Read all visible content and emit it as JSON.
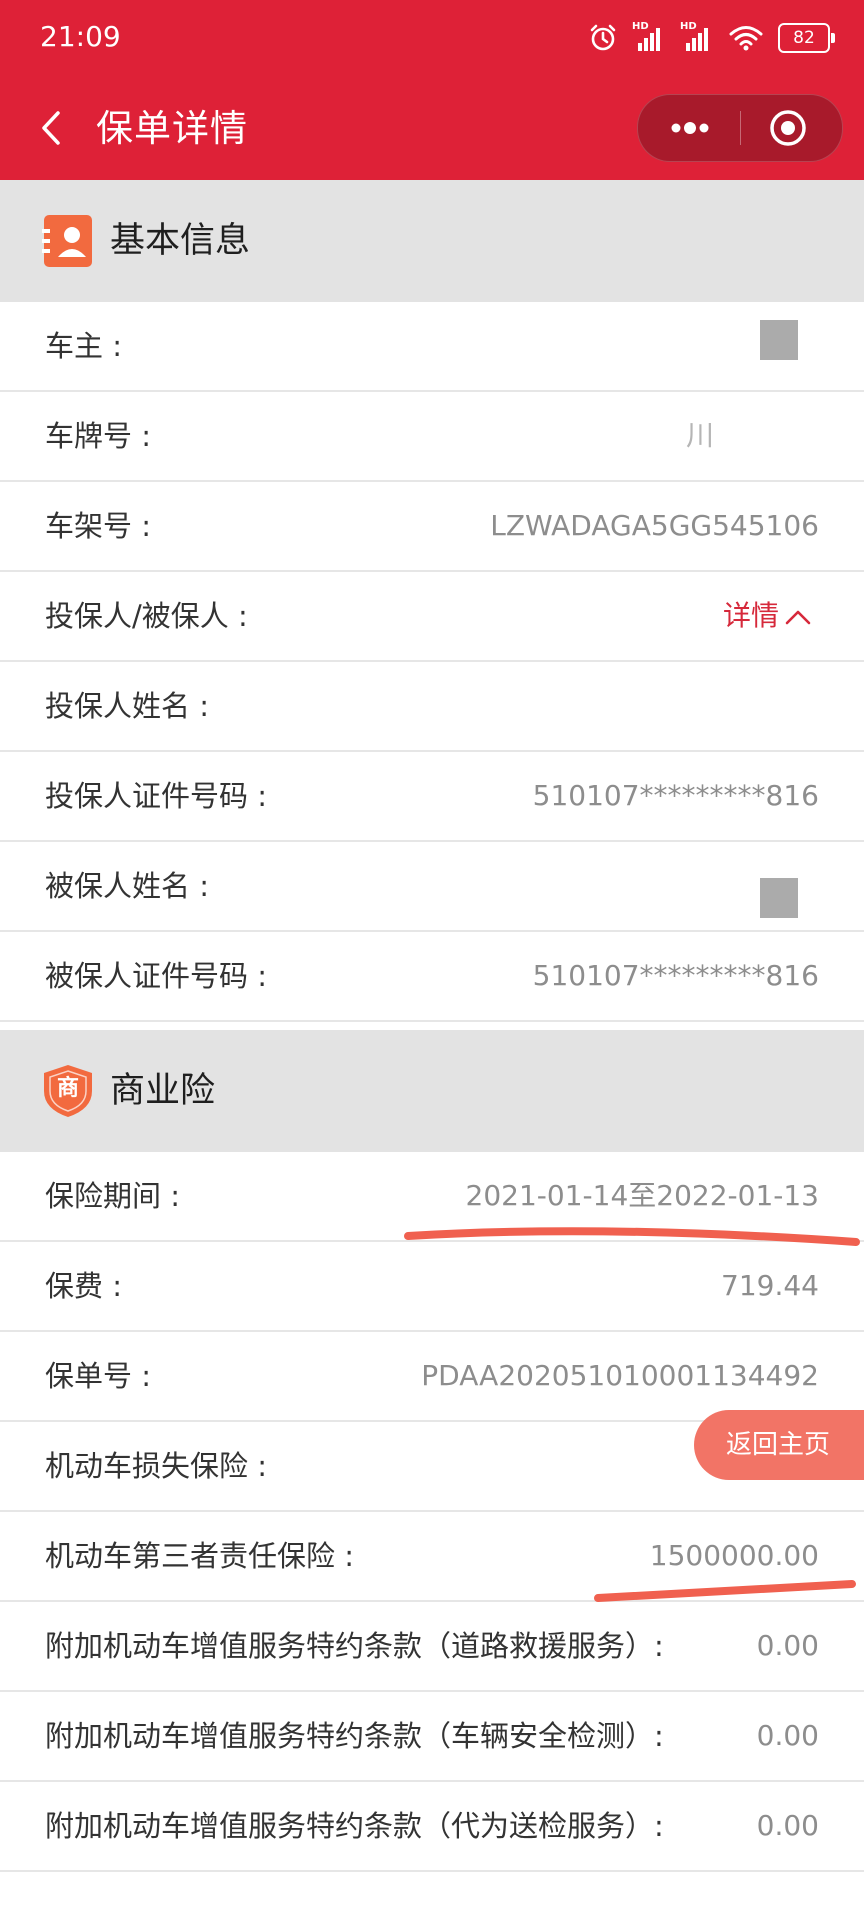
{
  "status_bar": {
    "time": "21:09",
    "battery": "82",
    "icons": [
      "alarm-icon",
      "hd-signal-icon",
      "hd-signal-icon",
      "wifi-icon",
      "battery-icon"
    ],
    "hd_label": "HD"
  },
  "nav": {
    "title": "保单详情",
    "icons": [
      "back-arrow-icon",
      "more-dots-icon",
      "target-icon"
    ]
  },
  "sections": {
    "basic": {
      "title": "基本信息",
      "icon": "contact-card-icon",
      "rows": [
        {
          "label": "车主 :",
          "value": ""
        },
        {
          "label": "车牌号 :",
          "value": "川"
        },
        {
          "label": "车架号 :",
          "value": "LZWADAGA5GG545106"
        },
        {
          "label": "投保人/被保人 :",
          "value": "详情"
        },
        {
          "label": "投保人姓名 :",
          "value": ""
        },
        {
          "label": "投保人证件号码 :",
          "value": "510107*********816"
        },
        {
          "label": "被保人姓名 :",
          "value": ""
        },
        {
          "label": "被保人证件号码 :",
          "value": "510107*********816"
        }
      ]
    },
    "commercial": {
      "title": "商业险",
      "icon": "shield-icon",
      "badge": "商",
      "rows": [
        {
          "label": "保险期间 :",
          "value": "2021-01-14至2022-01-13"
        },
        {
          "label": "保费 :",
          "value": "719.44"
        },
        {
          "label": "保单号 :",
          "value": "PDAA202051010001134492"
        },
        {
          "label": "机动车损失保险 :",
          "value": ""
        },
        {
          "label": "机动车第三者责任保险 :",
          "value": "1500000.00"
        },
        {
          "label": "附加机动车增值服务特约条款（道路救援服务）:",
          "value": "0.00"
        },
        {
          "label": "附加机动车增值服务特约条款（车辆安全检测）:",
          "value": "0.00"
        },
        {
          "label": "附加机动车增值服务特约条款（代为送检服务）:",
          "value": "0.00"
        }
      ]
    }
  },
  "floating": {
    "home_button": "返回主页"
  },
  "colors": {
    "brand_red": "#de2137",
    "capsule": "#a81a2b",
    "section_bg": "#e3e3e3",
    "value_gray": "#8d8d8d",
    "link_red": "#d6293b",
    "highlight_stroke": "#f0604f",
    "home_button": "#f27466"
  }
}
